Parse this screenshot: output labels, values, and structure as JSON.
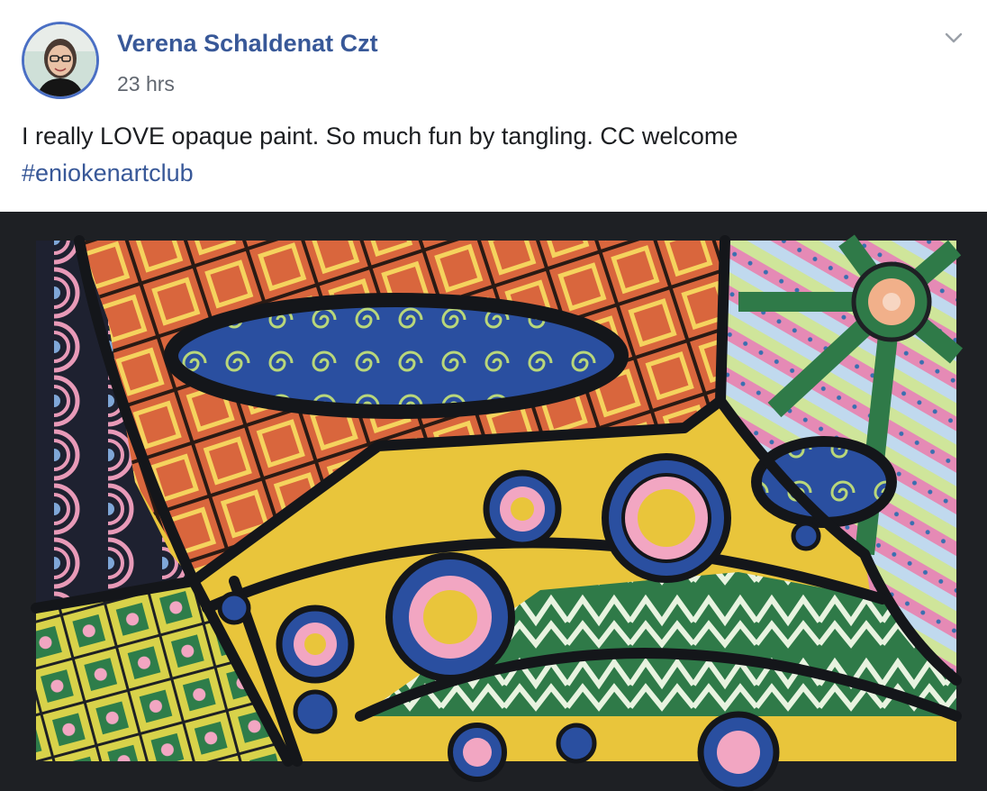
{
  "post": {
    "author": "Verena Schaldenat Czt",
    "timestamp": "23 hrs",
    "text": "I really LOVE opaque paint. So much fun by tangling. CC welcome",
    "hashtag": "#eniokenartclub"
  },
  "icons": {
    "menu": "chevron-down-icon",
    "avatar": "profile-photo"
  },
  "colors": {
    "link": "#385898",
    "avatar_ring": "#4a6fc4",
    "text": "#1c1e21",
    "muted": "#616770"
  }
}
